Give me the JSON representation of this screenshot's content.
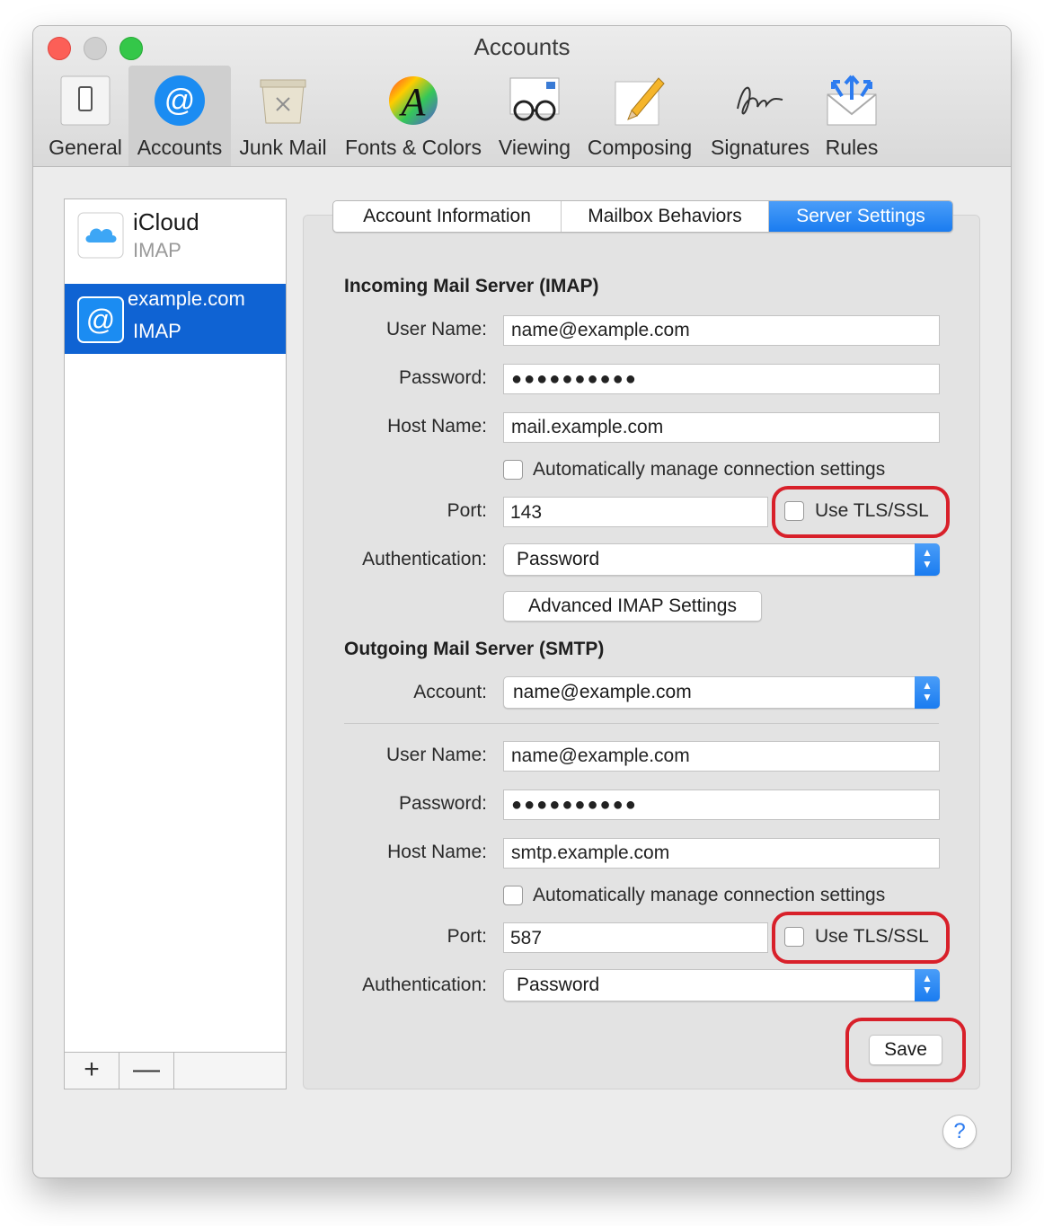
{
  "window": {
    "title": "Accounts"
  },
  "toolbar": {
    "items": [
      {
        "label": "General",
        "icon": "switch-icon"
      },
      {
        "label": "Accounts",
        "icon": "at-icon",
        "selected": true
      },
      {
        "label": "Junk Mail",
        "icon": "trash-icon"
      },
      {
        "label": "Fonts & Colors",
        "icon": "font-icon"
      },
      {
        "label": "Viewing",
        "icon": "glasses-icon"
      },
      {
        "label": "Composing",
        "icon": "pencil-icon"
      },
      {
        "label": "Signatures",
        "icon": "signature-icon"
      },
      {
        "label": "Rules",
        "icon": "envelope-arrows-icon"
      }
    ]
  },
  "accounts": [
    {
      "name": "iCloud",
      "type": "IMAP",
      "icon": "cloud-icon"
    },
    {
      "name": "example.com",
      "type": "IMAP",
      "icon": "at-icon",
      "selected": true
    }
  ],
  "list_buttons": {
    "add": "+",
    "remove": "—"
  },
  "tabs": [
    {
      "label": "Account Information"
    },
    {
      "label": "Mailbox Behaviors"
    },
    {
      "label": "Server Settings",
      "selected": true
    }
  ],
  "incoming": {
    "heading": "Incoming Mail Server (IMAP)",
    "user_label": "User Name:",
    "user": "name@example.com",
    "password_label": "Password:",
    "password": "●●●●●●●●●●",
    "host_label": "Host Name:",
    "host": "mail.example.com",
    "auto_label": "Automatically manage connection settings",
    "port_label": "Port:",
    "port": "143",
    "tls_label": "Use TLS/SSL",
    "auth_label": "Authentication:",
    "auth": "Password",
    "advanced_button": "Advanced IMAP Settings"
  },
  "outgoing": {
    "heading": "Outgoing Mail Server (SMTP)",
    "account_label": "Account:",
    "account": "name@example.com",
    "user_label": "User Name:",
    "user": "name@example.com",
    "password_label": "Password:",
    "password": "●●●●●●●●●●",
    "host_label": "Host Name:",
    "host": "smtp.example.com",
    "auto_label": "Automatically manage connection settings",
    "port_label": "Port:",
    "port": "587",
    "tls_label": "Use TLS/SSL",
    "auth_label": "Authentication:",
    "auth": "Password"
  },
  "save_button": "Save",
  "help_button": "?",
  "colors": {
    "accent": "#1a7cf0",
    "highlight": "#d8202a",
    "selection": "#0f63d3"
  }
}
